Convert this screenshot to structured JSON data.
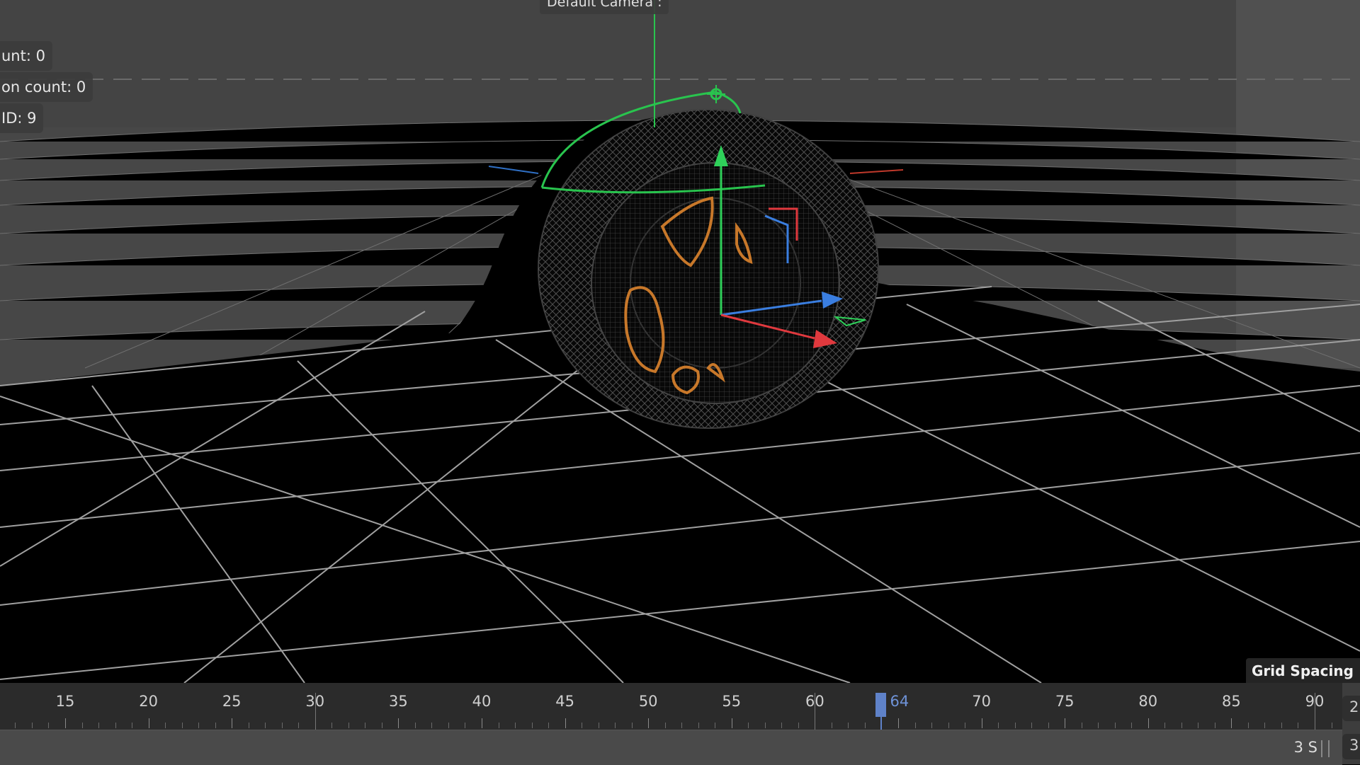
{
  "viewport": {
    "camera_label": "Default Camera :",
    "hud_lines": [
      "unt: 0",
      "on count: 0",
      "ID: 9"
    ],
    "grid_spacing_label": "Grid Spacing :",
    "object": "wheel-with-tire-wireframe",
    "colors": {
      "background_upper": "#4a4a4a",
      "ground_shadow": "#000000",
      "grid_line": "#9a9a9a",
      "axis_x": "#e0393e",
      "axis_y": "#2fd15a",
      "axis_z": "#3a7ee0",
      "rim_outline": "#c8782a"
    }
  },
  "timeline": {
    "frame_labels": [
      "15",
      "20",
      "25",
      "30",
      "35",
      "40",
      "45",
      "50",
      "55",
      "60",
      "70",
      "75",
      "80",
      "85",
      "90"
    ],
    "current_frame": "64",
    "duration": "3 S",
    "side_values": [
      "2",
      "3"
    ],
    "colors": {
      "playhead": "#5f82c9"
    }
  }
}
